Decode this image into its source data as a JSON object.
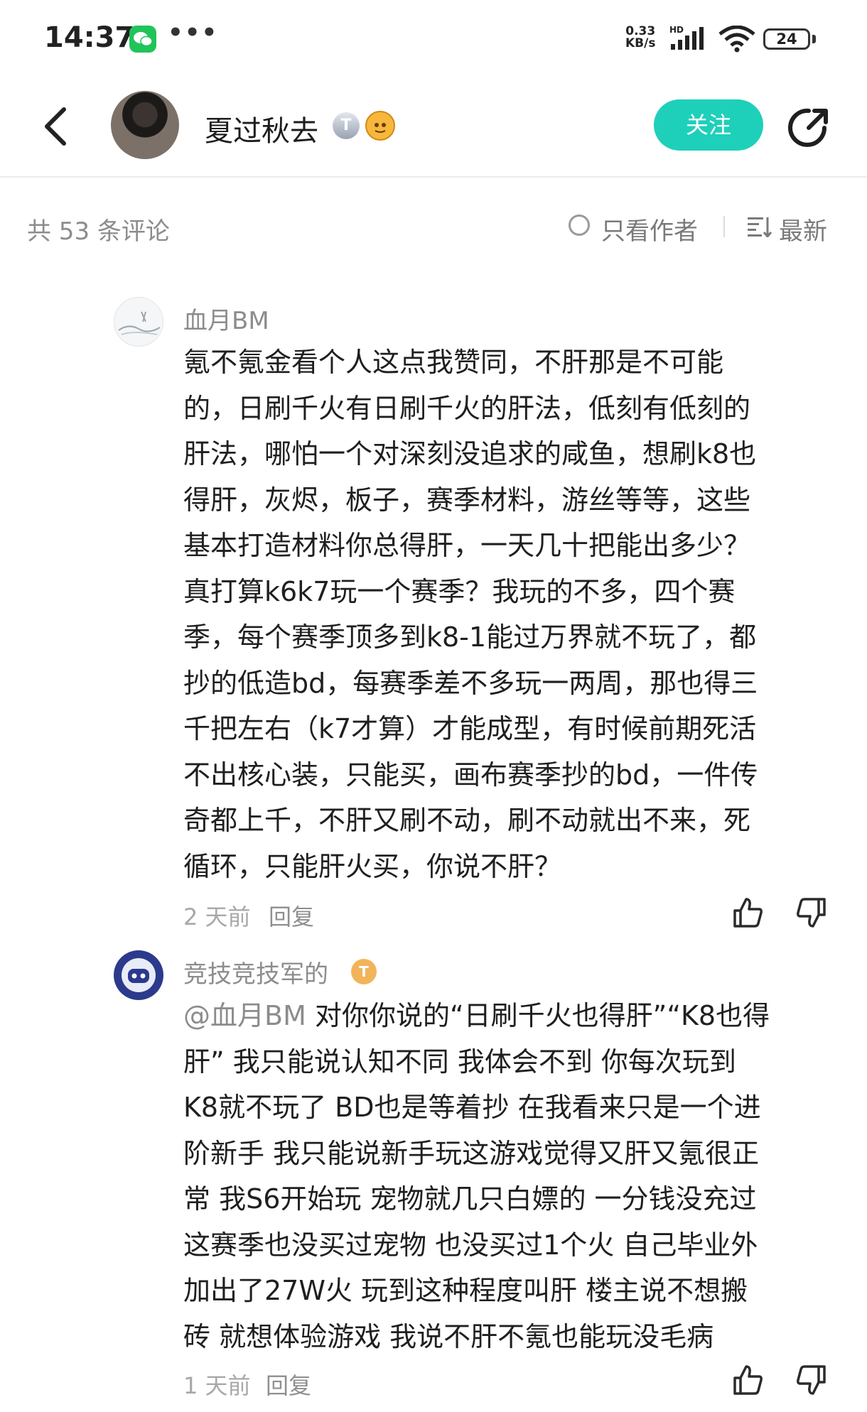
{
  "status_bar": {
    "time": "14:37",
    "dots": "•••",
    "net_speed_value": "0.33",
    "net_speed_unit": "KB/s",
    "hd": "HD",
    "battery": "24"
  },
  "header": {
    "author_name": "夏过秋去",
    "badge_text": "T",
    "follow_label": "关注"
  },
  "filter_bar": {
    "comment_count": "共 53 条评论",
    "author_only_label": "只看作者",
    "sort_label": "最新"
  },
  "comments": [
    {
      "username": "血月BM",
      "lines": [
        "氪不氪金看个人这点我赞同，不肝那是不可能",
        "的，日刷千火有日刷千火的肝法，低刻有低刻的",
        "肝法，哪怕一个对深刻没追求的咸鱼，想刷k8也",
        "得肝，灰烬，板子，赛季材料，游丝等等，这些",
        "基本打造材料你总得肝，一天几十把能出多少？",
        "真打算k6k7玩一个赛季？我玩的不多，四个赛",
        "季，每个赛季顶多到k8-1能过万界就不玩了，都",
        "抄的低造bd，每赛季差不多玩一两周，那也得三",
        "千把左右（k7才算）才能成型，有时候前期死活",
        "不出核心装，只能买，画布赛季抄的bd，一件传",
        "奇都上千，不肝又刷不动，刷不动就出不来，死",
        "循环，只能肝火买，你说不肝？"
      ],
      "time": "2 天前",
      "reply_label": "回复"
    },
    {
      "username": "竞技竞技军的",
      "badge_text": "T",
      "mention": "@血月BM",
      "lines": [
        " 对你你说的“日刷千火也得肝”“K8也得",
        "肝” 我只能说认知不同  我体会不到 你每次玩到",
        "K8就不玩了 BD也是等着抄 在我看来只是一个进",
        "阶新手  我只能说新手玩这游戏觉得又肝又氪很正",
        "常  我S6开始玩 宠物就几只白嫖的 一分钱没充过",
        "这赛季也没买过宠物 也没买过1个火 自己毕业外",
        "加出了27W火 玩到这种程度叫肝  楼主说不想搬",
        "砖 就想体验游戏 我说不肝不氪也能玩没毛病"
      ],
      "time": "1 天前",
      "reply_label": "回复"
    }
  ],
  "colors": {
    "accent": "#1ed0ba",
    "text": "#1f1f1f",
    "muted": "#8c8c8c"
  },
  "icons": [
    "back-arrow-icon",
    "share-icon",
    "wechat-icon",
    "wifi-icon",
    "signal-icon",
    "thumbs-up-icon",
    "thumbs-down-icon",
    "sort-icon",
    "radio-circle-icon"
  ]
}
